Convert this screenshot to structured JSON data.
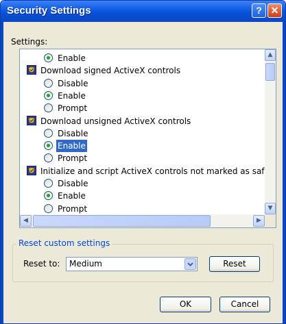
{
  "window": {
    "title": "Security Settings",
    "help_glyph": "?",
    "close_glyph": "✕"
  },
  "settings_label": "Settings:",
  "tree": [
    {
      "kind": "option",
      "label": "Enable",
      "checked": true
    },
    {
      "kind": "category",
      "label": "Download signed ActiveX controls"
    },
    {
      "kind": "option",
      "label": "Disable",
      "checked": false
    },
    {
      "kind": "option",
      "label": "Enable",
      "checked": true
    },
    {
      "kind": "option",
      "label": "Prompt",
      "checked": false
    },
    {
      "kind": "category",
      "label": "Download unsigned ActiveX controls"
    },
    {
      "kind": "option",
      "label": "Disable",
      "checked": false
    },
    {
      "kind": "option",
      "label": "Enable",
      "checked": true,
      "selected": true
    },
    {
      "kind": "option",
      "label": "Prompt",
      "checked": false
    },
    {
      "kind": "category",
      "label": "Initialize and script ActiveX controls not marked as safe"
    },
    {
      "kind": "option",
      "label": "Disable",
      "checked": false
    },
    {
      "kind": "option",
      "label": "Enable",
      "checked": true
    },
    {
      "kind": "option",
      "label": "Prompt",
      "checked": false
    }
  ],
  "reset_group": {
    "legend": "Reset custom settings",
    "reset_to_label": "Reset to:",
    "selected_value": "Medium",
    "reset_button": "Reset"
  },
  "footer": {
    "ok_label": "OK",
    "cancel_label": "Cancel"
  },
  "colors": {
    "titlebar": "#0a4fd3",
    "selection": "#316ac5",
    "radio_dot": "#21a121",
    "group_legend": "#0046d5"
  }
}
